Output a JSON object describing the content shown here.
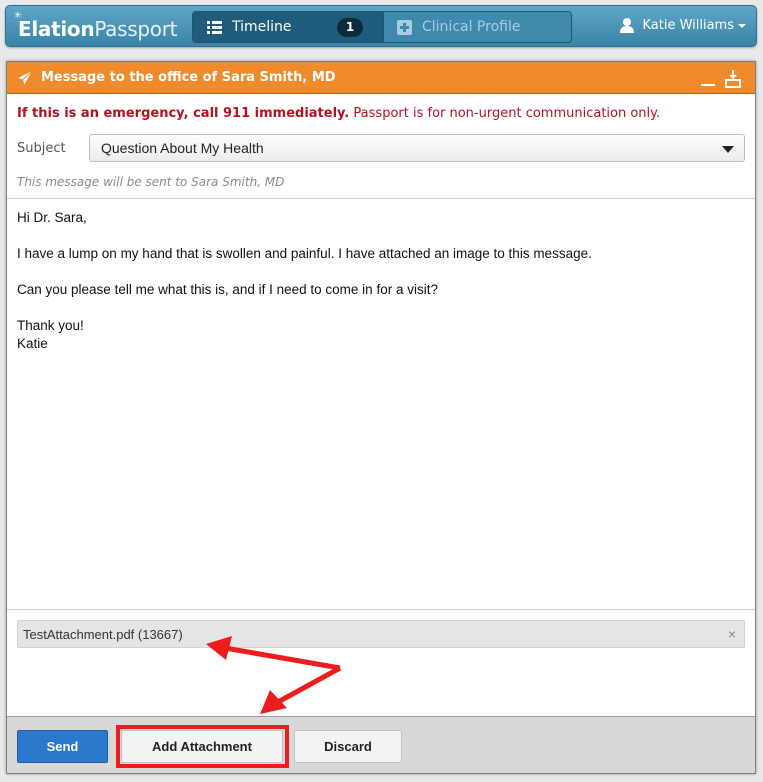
{
  "app": {
    "logo_bold": "Elation",
    "logo_light": "Passport"
  },
  "nav": {
    "tabs": [
      {
        "label": "Timeline",
        "icon": "list-icon",
        "badge": "1",
        "active": true
      },
      {
        "label": "Clinical Profile",
        "icon": "medical-cross-icon",
        "active": false
      }
    ],
    "user": {
      "name": "Katie Williams",
      "icon": "user-icon"
    }
  },
  "message_panel": {
    "title": "Message to the office of Sara Smith, MD",
    "header_color": "#ef8b2c",
    "warning_bold": "If this is an emergency, call 911 immediately.",
    "warning_rest": "Passport is for non-urgent communication only.",
    "subject_label": "Subject",
    "subject_value": "Question About My Health",
    "send_to_note": "This message will be sent to Sara Smith, MD",
    "body_lines": [
      "Hi Dr. Sara,",
      "I have a lump on my hand that is swollen and painful. I have attached an image to this message.",
      "Can you please tell me what this is, and if I need to come in for a visit?",
      "Thank you!",
      "Katie"
    ],
    "attachment": {
      "filename": "TestAttachment.pdf (13667)",
      "remove_label": "×"
    },
    "buttons": {
      "send": "Send",
      "add_attachment": "Add Attachment",
      "discard": "Discard"
    }
  },
  "annotation": {
    "color": "#ee1c1c",
    "highlighted": "Add Attachment"
  }
}
